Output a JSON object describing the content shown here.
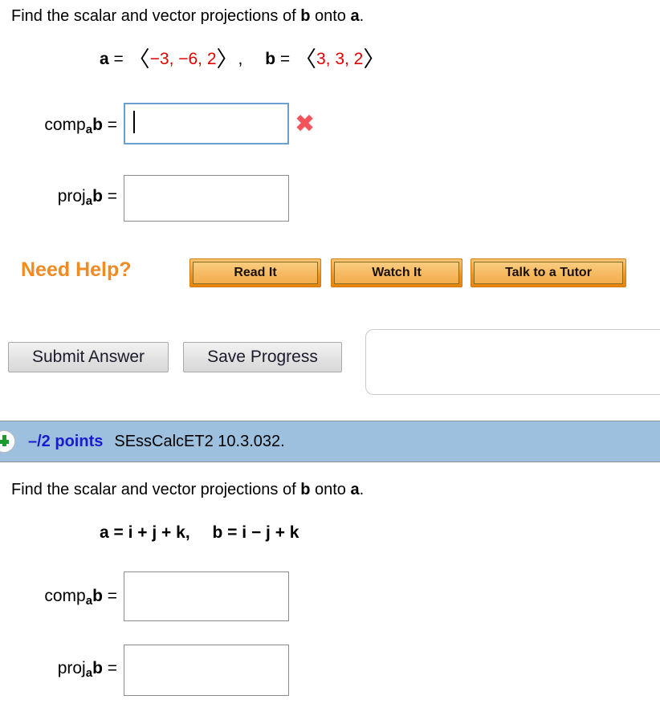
{
  "problem_top": {
    "prompt": {
      "text_before": "Find the scalar and vector projections of ",
      "b": "b",
      "text_middle": " onto ",
      "a": "a",
      "text_after": "."
    },
    "equation": {
      "a_label": "a",
      "a_eq": " = ",
      "a_open": "〈",
      "a_components": "−3, −6, 2",
      "a_close": "〉",
      "a_comma": ",",
      "b_label": "b",
      "b_eq": " = ",
      "b_open": "〈",
      "b_components": "3, 3, 2",
      "b_close": "〉"
    },
    "answers": [
      {
        "label_main": "comp",
        "label_sub": "a",
        "label_vec": "b",
        "label_eq": " =",
        "value": "",
        "focused": true,
        "mark": "✖"
      },
      {
        "label_main": "proj",
        "label_sub": "a",
        "label_vec": "b",
        "label_eq": " =",
        "value": "",
        "focused": false,
        "mark": ""
      }
    ],
    "need_help": {
      "label": "Need Help?",
      "buttons": [
        {
          "label": "Read It"
        },
        {
          "label": "Watch It"
        },
        {
          "label": "Talk to a Tutor"
        }
      ]
    },
    "form_buttons": [
      {
        "label": "Submit Answer"
      },
      {
        "label": "Save Progress"
      }
    ]
  },
  "problem_bottom": {
    "header": {
      "icon": "plus-circle-icon",
      "points": "–/2 points",
      "question_id": "SEssCalcET2 10.3.032."
    },
    "prompt": {
      "text_before": "Find the scalar and vector projections of ",
      "b": "b",
      "text_middle": " onto ",
      "a": "a",
      "text_after": "."
    },
    "equation": {
      "a_expr": "a = i + j + k,",
      "b_expr": "b = i − j + k"
    },
    "answers": [
      {
        "label_main": "comp",
        "label_sub": "a",
        "label_vec": "b",
        "label_eq": " =",
        "value": "",
        "focused": false
      },
      {
        "label_main": "proj",
        "label_sub": "a",
        "label_vec": "b",
        "label_eq": " =",
        "value": "",
        "focused": false
      }
    ]
  },
  "colors": {
    "vector_number_red": "#e00000",
    "points_blue": "#1b1bd0",
    "header_bar_blue": "#9cc0de",
    "need_help_orange": "#f08a22",
    "button_orange": "#eb9522",
    "xmark_red": "#f2545b",
    "focus_border_blue": "#6aa0d0"
  }
}
